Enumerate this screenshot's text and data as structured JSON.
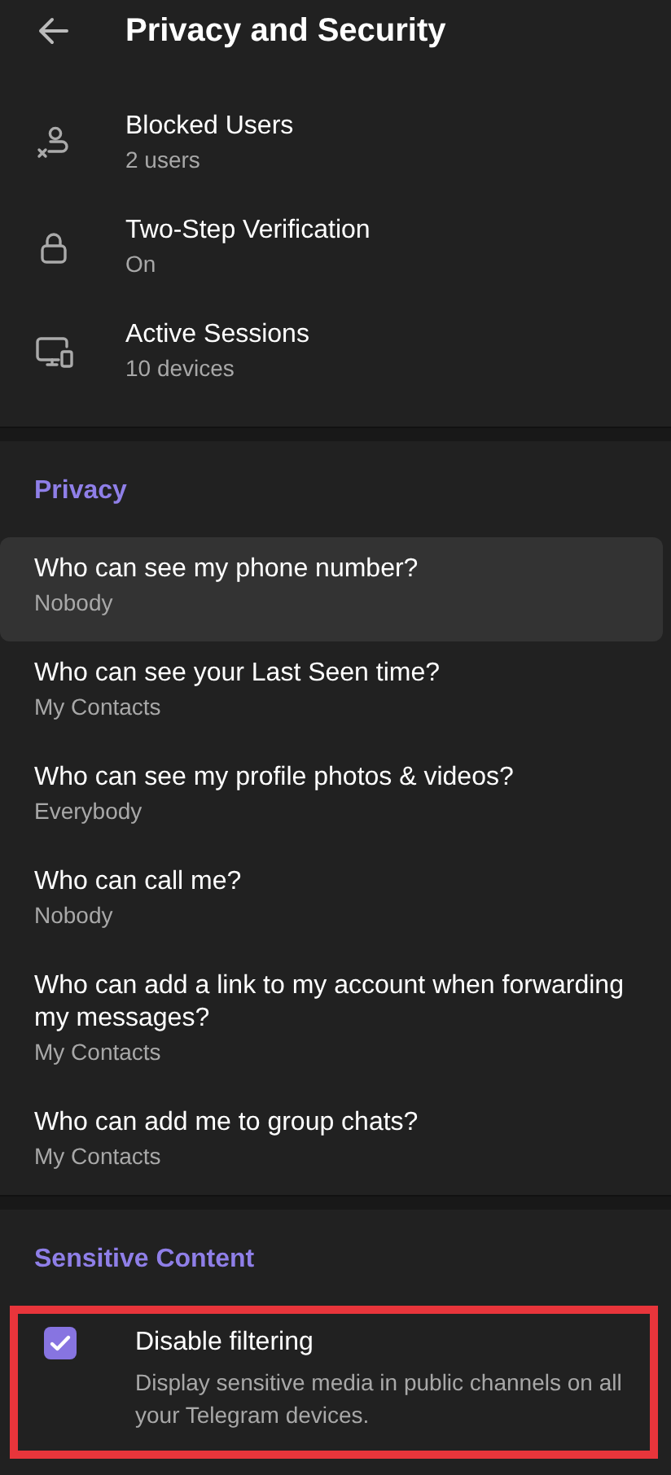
{
  "header": {
    "title": "Privacy and Security"
  },
  "security_items": [
    {
      "kind": "blocked",
      "title": "Blocked Users",
      "subtitle": "2 users"
    },
    {
      "kind": "lock",
      "title": "Two-Step Verification",
      "subtitle": "On"
    },
    {
      "kind": "devices",
      "title": "Active Sessions",
      "subtitle": "10 devices"
    }
  ],
  "privacy": {
    "heading": "Privacy",
    "items": [
      {
        "title": "Who can see my phone number?",
        "subtitle": "Nobody",
        "hovered": true
      },
      {
        "title": "Who can see your Last Seen time?",
        "subtitle": "My Contacts",
        "hovered": false
      },
      {
        "title": "Who can see my profile photos & videos?",
        "subtitle": "Everybody",
        "hovered": false
      },
      {
        "title": "Who can call me?",
        "subtitle": "Nobody",
        "hovered": false
      },
      {
        "title": "Who can add a link to my account when forwarding my messages?",
        "subtitle": "My Contacts",
        "hovered": false
      },
      {
        "title": "Who can add me to group chats?",
        "subtitle": "My Contacts",
        "hovered": false
      }
    ]
  },
  "sensitive_content": {
    "heading": "Sensitive Content",
    "option": {
      "title": "Disable filtering",
      "description": "Display sensitive media in public channels on all your Telegram devices.",
      "checked": true,
      "outlined": true
    }
  }
}
